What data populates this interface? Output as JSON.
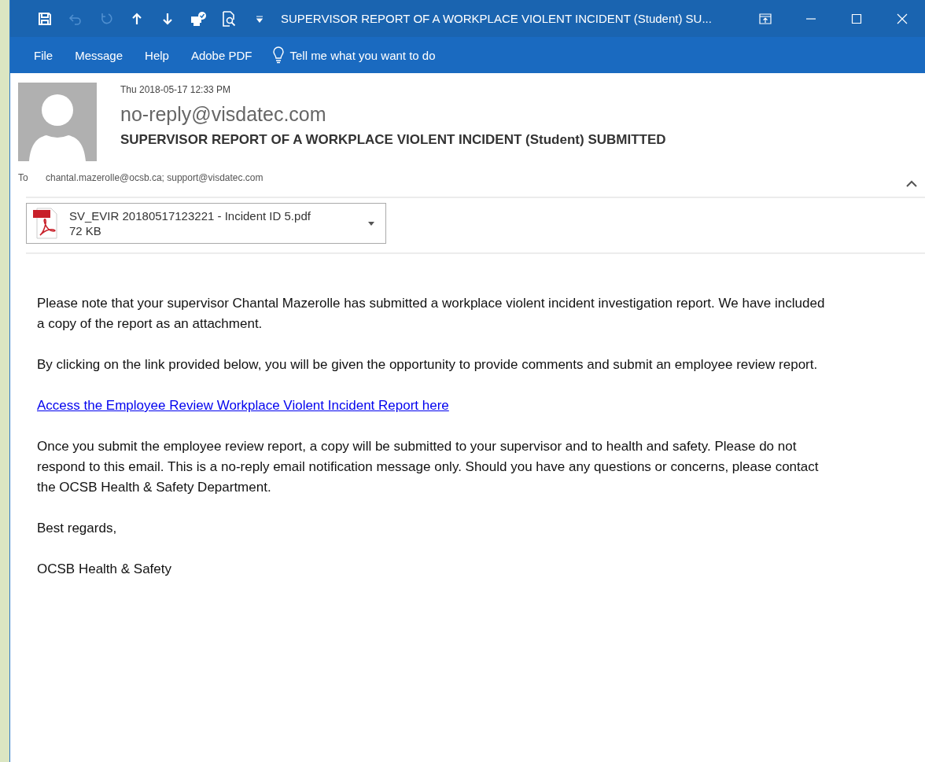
{
  "window": {
    "title": "SUPERVISOR REPORT OF A WORKPLACE VIOLENT INCIDENT (Student) SU...",
    "quick_access": [
      {
        "kind": "save",
        "disabled": false
      },
      {
        "kind": "undo",
        "disabled": true
      },
      {
        "kind": "redo",
        "disabled": true
      },
      {
        "kind": "up",
        "disabled": false
      },
      {
        "kind": "down",
        "disabled": false
      },
      {
        "kind": "print",
        "disabled": false
      },
      {
        "kind": "preview",
        "disabled": false
      },
      {
        "kind": "customize",
        "disabled": false
      }
    ]
  },
  "ribbon": {
    "tabs": [
      {
        "label": "File"
      },
      {
        "label": "Message"
      },
      {
        "label": "Help"
      },
      {
        "label": "Adobe PDF"
      }
    ],
    "tell_me": "Tell me what you want to do"
  },
  "message": {
    "date": "Thu 2018-05-17 12:33 PM",
    "from": "no-reply@visdatec.com",
    "subject": "SUPERVISOR REPORT OF A WORKPLACE VIOLENT INCIDENT (Student) SUBMITTED",
    "to_label": "To",
    "to": "chantal.mazerolle@ocsb.ca; support@visdatec.com",
    "attachment": {
      "name": "SV_EVIR 20180517123221 - Incident ID 5.pdf",
      "size": "72 KB"
    },
    "body": [
      {
        "kind": "text",
        "text": "Please note that your supervisor Chantal Mazerolle has submitted a workplace violent incident investigation report. We have included a copy of the report as an attachment."
      },
      {
        "kind": "text",
        "text": "By clicking on the link provided below, you will be given the opportunity to provide comments and submit an employee review report."
      },
      {
        "kind": "link",
        "text": "Access the Employee Review Workplace Violent Incident Report here"
      },
      {
        "kind": "text",
        "text": "Once you submit the employee review report, a copy will be submitted to your supervisor and to health and safety. Please do not respond to this email. This is a no-reply email notification message only. Should you have any questions or concerns, please contact the OCSB Health & Safety Department."
      },
      {
        "kind": "text",
        "text": "Best regards,"
      },
      {
        "kind": "text",
        "text": "OCSB Health & Safety"
      }
    ]
  }
}
